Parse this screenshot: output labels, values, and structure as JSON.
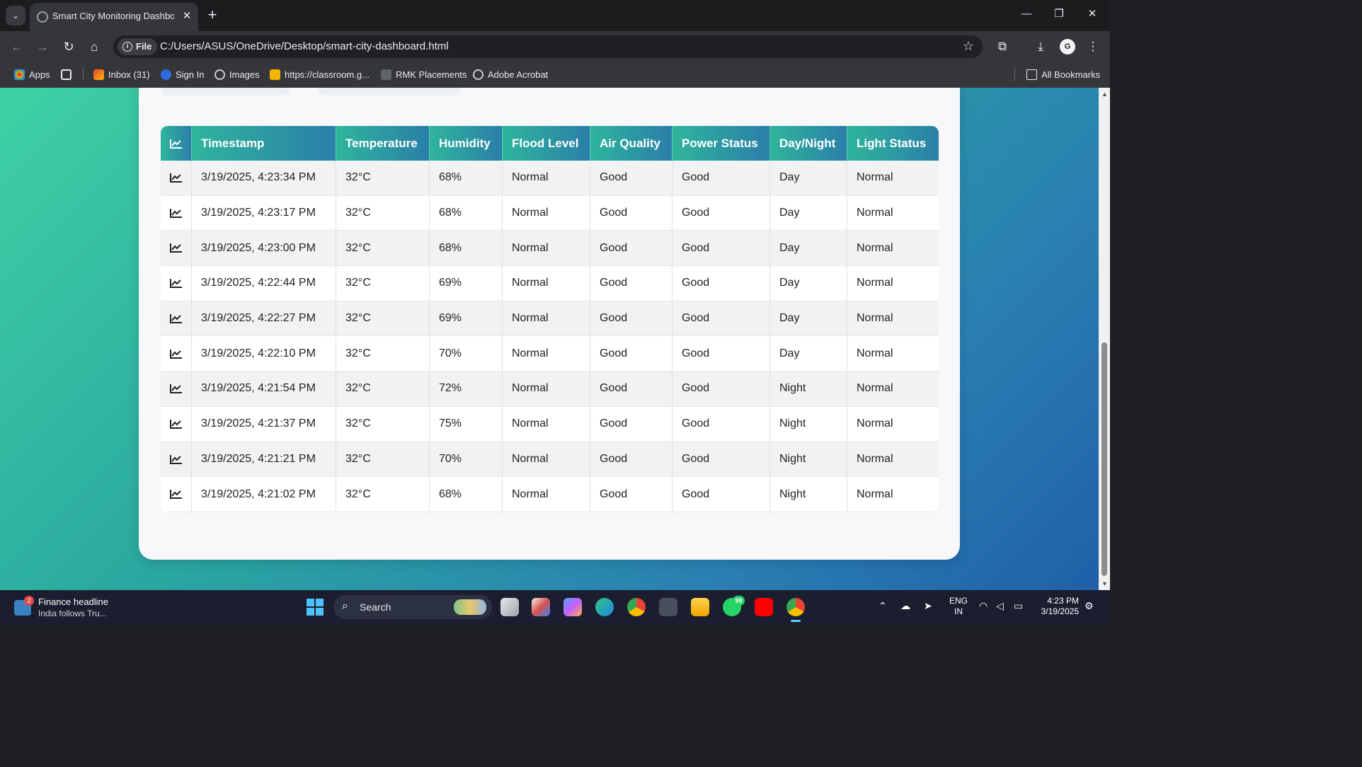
{
  "browser": {
    "tab_title": "Smart City Monitoring Dashboard",
    "address_scheme_label": "File",
    "url": "C:/Users/ASUS/OneDrive/Desktop/smart-city-dashboard.html",
    "profile_initial": "G",
    "bookmarks": [
      {
        "label": "Apps",
        "icon": "apps-grid-icon"
      },
      {
        "label": "Inbox (31)",
        "icon": "gmail-icon"
      },
      {
        "label": "Sign In",
        "icon": "zm-icon"
      },
      {
        "label": "Images",
        "icon": "globe-icon"
      },
      {
        "label": "https://classroom.g...",
        "icon": "classroom-icon"
      },
      {
        "label": "RMK Placements",
        "icon": "rmk-icon"
      },
      {
        "label": "Adobe Acrobat",
        "icon": "globe-icon"
      }
    ],
    "all_bookmarks_label": "All Bookmarks"
  },
  "table": {
    "headers": [
      "Timestamp",
      "Temperature",
      "Humidity",
      "Flood Level",
      "Air Quality",
      "Power Status",
      "Day/Night",
      "Light Status"
    ],
    "rows": [
      [
        "3/19/2025, 4:23:34 PM",
        "32°C",
        "68%",
        "Normal",
        "Good",
        "Good",
        "Day",
        "Normal"
      ],
      [
        "3/19/2025, 4:23:17 PM",
        "32°C",
        "68%",
        "Normal",
        "Good",
        "Good",
        "Day",
        "Normal"
      ],
      [
        "3/19/2025, 4:23:00 PM",
        "32°C",
        "68%",
        "Normal",
        "Good",
        "Good",
        "Day",
        "Normal"
      ],
      [
        "3/19/2025, 4:22:44 PM",
        "32°C",
        "69%",
        "Normal",
        "Good",
        "Good",
        "Day",
        "Normal"
      ],
      [
        "3/19/2025, 4:22:27 PM",
        "32°C",
        "69%",
        "Normal",
        "Good",
        "Good",
        "Day",
        "Normal"
      ],
      [
        "3/19/2025, 4:22:10 PM",
        "32°C",
        "70%",
        "Normal",
        "Good",
        "Good",
        "Day",
        "Normal"
      ],
      [
        "3/19/2025, 4:21:54 PM",
        "32°C",
        "72%",
        "Normal",
        "Good",
        "Good",
        "Night",
        "Normal"
      ],
      [
        "3/19/2025, 4:21:37 PM",
        "32°C",
        "75%",
        "Normal",
        "Good",
        "Good",
        "Night",
        "Normal"
      ],
      [
        "3/19/2025, 4:21:21 PM",
        "32°C",
        "70%",
        "Normal",
        "Good",
        "Good",
        "Night",
        "Normal"
      ],
      [
        "3/19/2025, 4:21:02 PM",
        "32°C",
        "68%",
        "Normal",
        "Good",
        "Good",
        "Night",
        "Normal"
      ]
    ]
  },
  "taskbar": {
    "news_badge": "2",
    "news_headline": "Finance headline",
    "news_subtext": "India follows Tru...",
    "search_label": "Search",
    "whatsapp_badge": "99",
    "lang_line1": "ENG",
    "lang_line2": "IN",
    "time": "4:23 PM",
    "date": "3/19/2025"
  },
  "colors": {
    "header_start": "#2fb59c",
    "header_end": "#2a7fa8",
    "page_gradient_start": "#3fd1a4",
    "page_gradient_end": "#1f5fa8"
  }
}
